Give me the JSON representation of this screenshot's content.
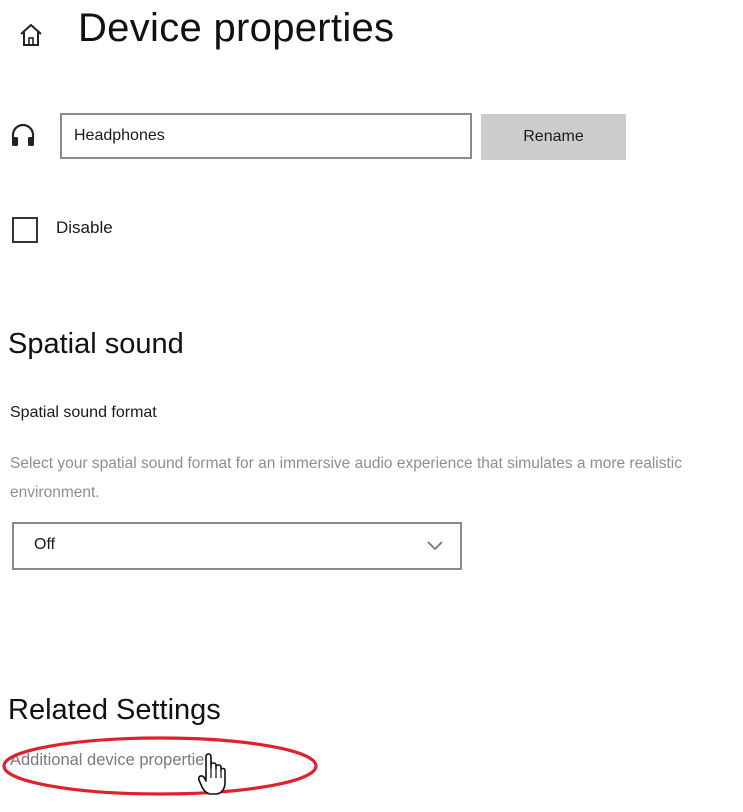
{
  "header": {
    "title": "Device properties",
    "home_icon": "home-icon"
  },
  "device": {
    "icon": "headphones-icon",
    "name_value": "Headphones",
    "rename_label": "Rename",
    "disable_label": "Disable",
    "disable_checked": false
  },
  "spatial_sound": {
    "heading": "Spatial sound",
    "format_label": "Spatial sound format",
    "description": "Select your spatial sound format for an immersive audio experience that simulates a more realistic environment.",
    "selected_format": "Off"
  },
  "related_settings": {
    "heading": "Related Settings",
    "link_label": "Additional device properties"
  },
  "annotation": {
    "color": "#e0212b"
  }
}
